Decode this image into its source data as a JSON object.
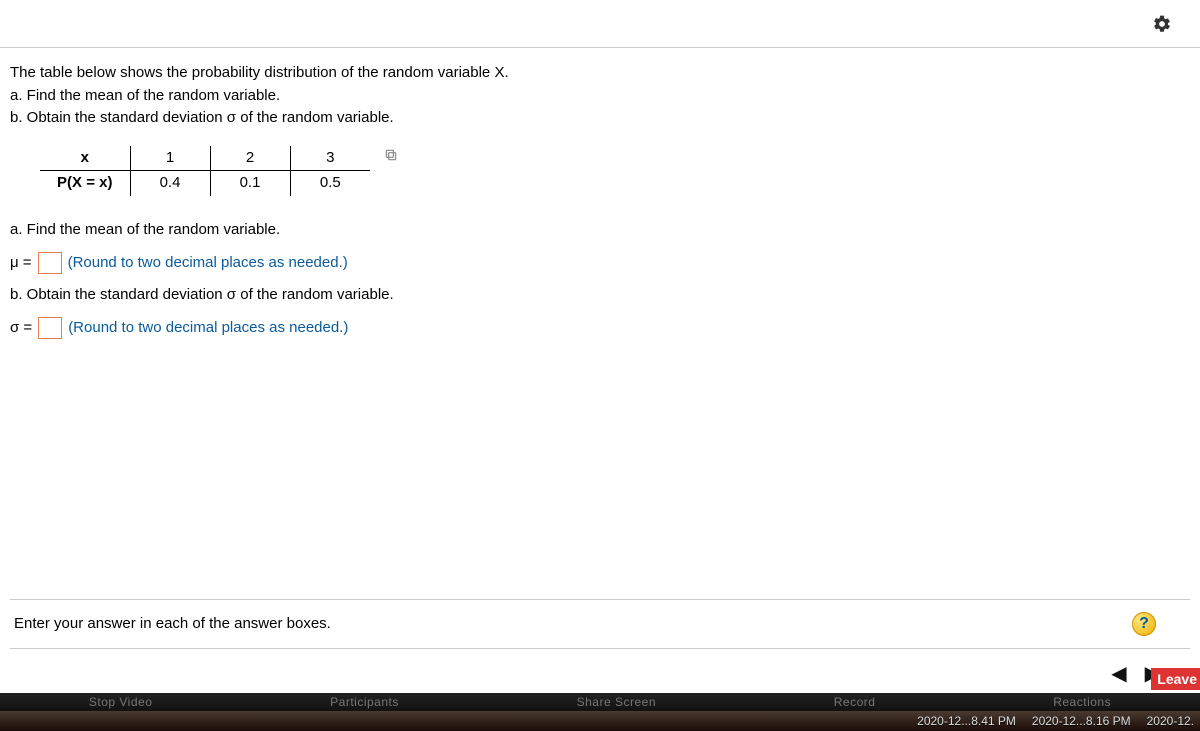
{
  "header": {
    "gear_icon": "gear"
  },
  "question": {
    "intro": "The table below shows the probability distribution of the random variable X.",
    "part_a": "a. Find the mean of the random variable.",
    "part_b": "b. Obtain the standard deviation σ of the random variable.",
    "table": {
      "row1_label": "x",
      "row2_label": "P(X = x)",
      "cols": [
        "1",
        "2",
        "3"
      ],
      "probs": [
        "0.4",
        "0.1",
        "0.5"
      ]
    },
    "a_prompt": "a. Find the mean of the random variable.",
    "mu_prefix": "μ =",
    "mu_hint": "(Round to two decimal places as needed.)",
    "b_prompt": "b. Obtain the standard deviation σ of the random variable.",
    "sigma_prefix": "σ =",
    "sigma_hint": "(Round to two decimal places as needed.)"
  },
  "footer": {
    "hint": "Enter your answer in each of the answer boxes.",
    "help": "?"
  },
  "pager": {
    "prev": "◀",
    "next": "▶"
  },
  "leave": "Leave",
  "zoom_labels": [
    "Stop Video",
    "Participants",
    "Share Screen",
    "Record",
    "Reactions"
  ],
  "taskbar": [
    "2020-12...8.41 PM",
    "2020-12...8.16 PM",
    "2020-12."
  ]
}
